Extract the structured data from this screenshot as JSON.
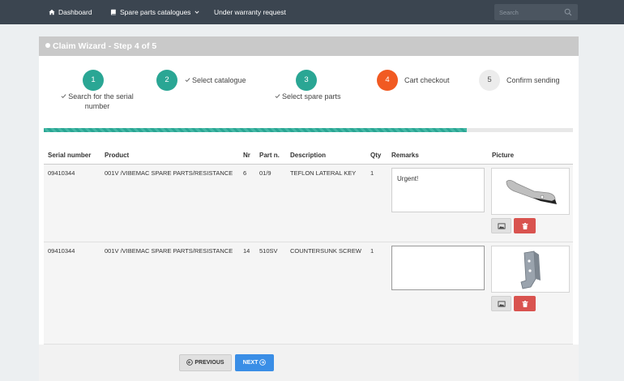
{
  "nav": {
    "dashboard": "Dashboard",
    "spare_parts": "Spare parts catalogues",
    "warranty": "Under warranty request",
    "search_placeholder": "Search"
  },
  "panel": {
    "title": "Claim Wizard - Step 4 of 5"
  },
  "steps": [
    {
      "number": "1",
      "label_line1": "Search for the serial",
      "label_line2": "number",
      "state": "done"
    },
    {
      "number": "2",
      "label": "Select catalogue",
      "state": "done"
    },
    {
      "number": "3",
      "label": "Select spare parts",
      "state": "done"
    },
    {
      "number": "4",
      "label": "Cart checkout",
      "state": "active"
    },
    {
      "number": "5",
      "label": "Confirm sending",
      "state": "todo"
    }
  ],
  "progress": {
    "fraction": 0.8
  },
  "table": {
    "headers": [
      "Serial number",
      "Product",
      "Nr",
      "Part n.",
      "Description",
      "Qty",
      "Remarks",
      "Picture"
    ],
    "rows": [
      {
        "serial": "09410344",
        "product": "001V /VIBEMAC SPARE PARTS/RESISTANCE",
        "nr": "6",
        "part": "01/9",
        "description": "TEFLON LATERAL KEY",
        "qty": "1",
        "remarks": "Urgent!"
      },
      {
        "serial": "09410344",
        "product": "001V /VIBEMAC SPARE PARTS/RESISTANCE",
        "nr": "14",
        "part": "510SV",
        "description": "COUNTERSUNK SCREW",
        "qty": "1",
        "remarks": ""
      }
    ]
  },
  "footer": {
    "previous": "PREVIOUS",
    "next": "NEXT"
  },
  "colors": {
    "navbar": "#3b4550",
    "step_done": "#2aa694",
    "step_active": "#f15a22",
    "delete": "#d9534f",
    "next": "#3a8ee6"
  }
}
